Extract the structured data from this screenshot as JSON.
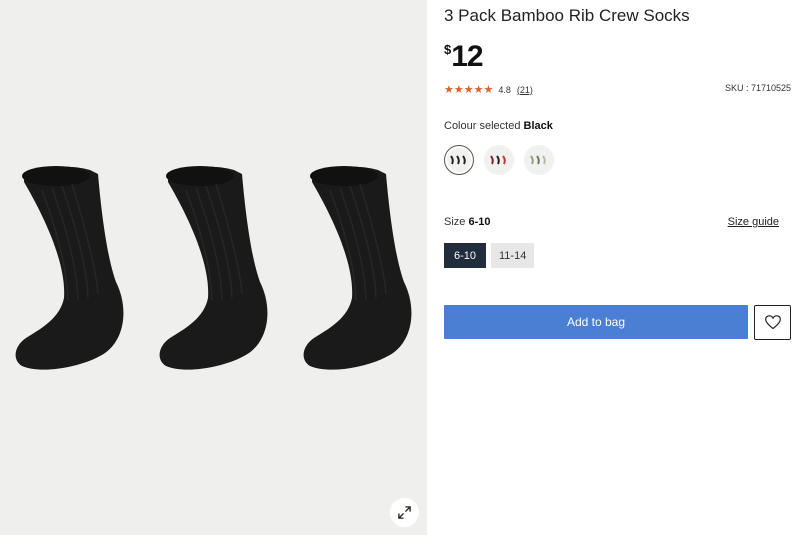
{
  "product": {
    "title": "3 Pack Bamboo Rib Crew Socks",
    "currency_symbol": "$",
    "price": "12",
    "stars": "★★★★★",
    "rating": "4.8",
    "review_count": "(21)",
    "sku": "SKU : 71710525"
  },
  "colour": {
    "label": "Colour selected ",
    "selected": "Black",
    "swatches": [
      {
        "name": "Black",
        "colors": [
          "#222222",
          "#222222",
          "#222222"
        ]
      },
      {
        "name": "Multi red",
        "colors": [
          "#7a2a2a",
          "#222222",
          "#c0392b"
        ]
      },
      {
        "name": "Multi neutral",
        "colors": [
          "#9a9a8a",
          "#6b7a5a",
          "#b8b8a8"
        ]
      }
    ]
  },
  "size": {
    "label": "Size ",
    "selected": "6-10",
    "guide_label": "Size guide",
    "options": [
      "6-10",
      "11-14"
    ]
  },
  "actions": {
    "add_to_bag": "Add to bag"
  },
  "icons": {
    "expand": "expand-icon",
    "wishlist": "heart-icon"
  },
  "colors": {
    "add_button": "#4a7fd4",
    "selected_size": "#1f2d3d",
    "star": "#d9632b",
    "gallery_bg": "#efefed",
    "sock": "#1a1a1a"
  }
}
